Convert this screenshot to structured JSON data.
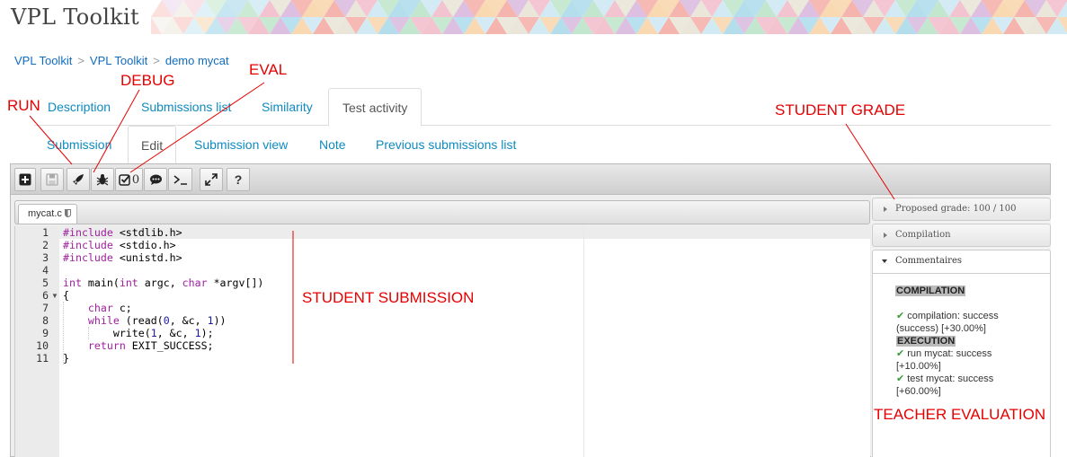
{
  "site": {
    "title": "VPL Toolkit"
  },
  "breadcrumb": [
    "VPL Toolkit",
    "VPL Toolkit",
    "demo mycat"
  ],
  "tabs": [
    {
      "label": "Description",
      "active": false
    },
    {
      "label": "Submissions list",
      "active": false
    },
    {
      "label": "Similarity",
      "active": false
    },
    {
      "label": "Test activity",
      "active": true
    }
  ],
  "subtabs": [
    {
      "label": "Submission",
      "active": false
    },
    {
      "label": "Edit",
      "active": true
    },
    {
      "label": "Submission view",
      "active": false
    },
    {
      "label": "Note",
      "active": false
    },
    {
      "label": "Previous submissions list",
      "active": false
    }
  ],
  "toolbar": {
    "buttons": [
      "new-file-icon",
      "save-icon",
      "run-icon",
      "debug-icon",
      "evaluate-icon",
      "comments-icon",
      "console-icon",
      "fullscreen-icon",
      "help-icon"
    ],
    "eval_count": "0"
  },
  "file": {
    "name": "mycat.c"
  },
  "code": {
    "line_numbers": [
      "1",
      "2",
      "3",
      "4",
      "5",
      "6",
      "7",
      "8",
      "9",
      "10",
      "11"
    ],
    "lines": [
      "#include <stdlib.h>",
      "#include <stdio.h>",
      "#include <unistd.h>",
      "",
      "int main(int argc, char *argv[])",
      "{",
      "    char c;",
      "    while (read(0, &c, 1))",
      "        write(1, &c, 1);",
      "    return EXIT_SUCCESS;",
      "}"
    ]
  },
  "panel": {
    "grade": "Proposed grade: 100 / 100",
    "compilation": "Compilation",
    "comments_title": "Commentaires",
    "comments": {
      "h1": "COMPILATION",
      "l1a": "compilation: success",
      "l1b": "(success) [+30.00%]",
      "h2": "EXECUTION",
      "l2a": "run mycat: success",
      "l2b": "[+10.00%]",
      "l3a": "test mycat: success",
      "l3b": "[+60.00%]"
    }
  },
  "annotations": {
    "run": "RUN",
    "debug": "DEBUG",
    "eval": "EVAL",
    "student_grade": "STUDENT GRADE",
    "student_submission": "STUDENT SUBMISSION",
    "teacher_evaluation": "TEACHER EVALUATION"
  },
  "colors": {
    "link": "#0f8abf",
    "annotation": "#e60000",
    "check": "#3a9a3a"
  }
}
